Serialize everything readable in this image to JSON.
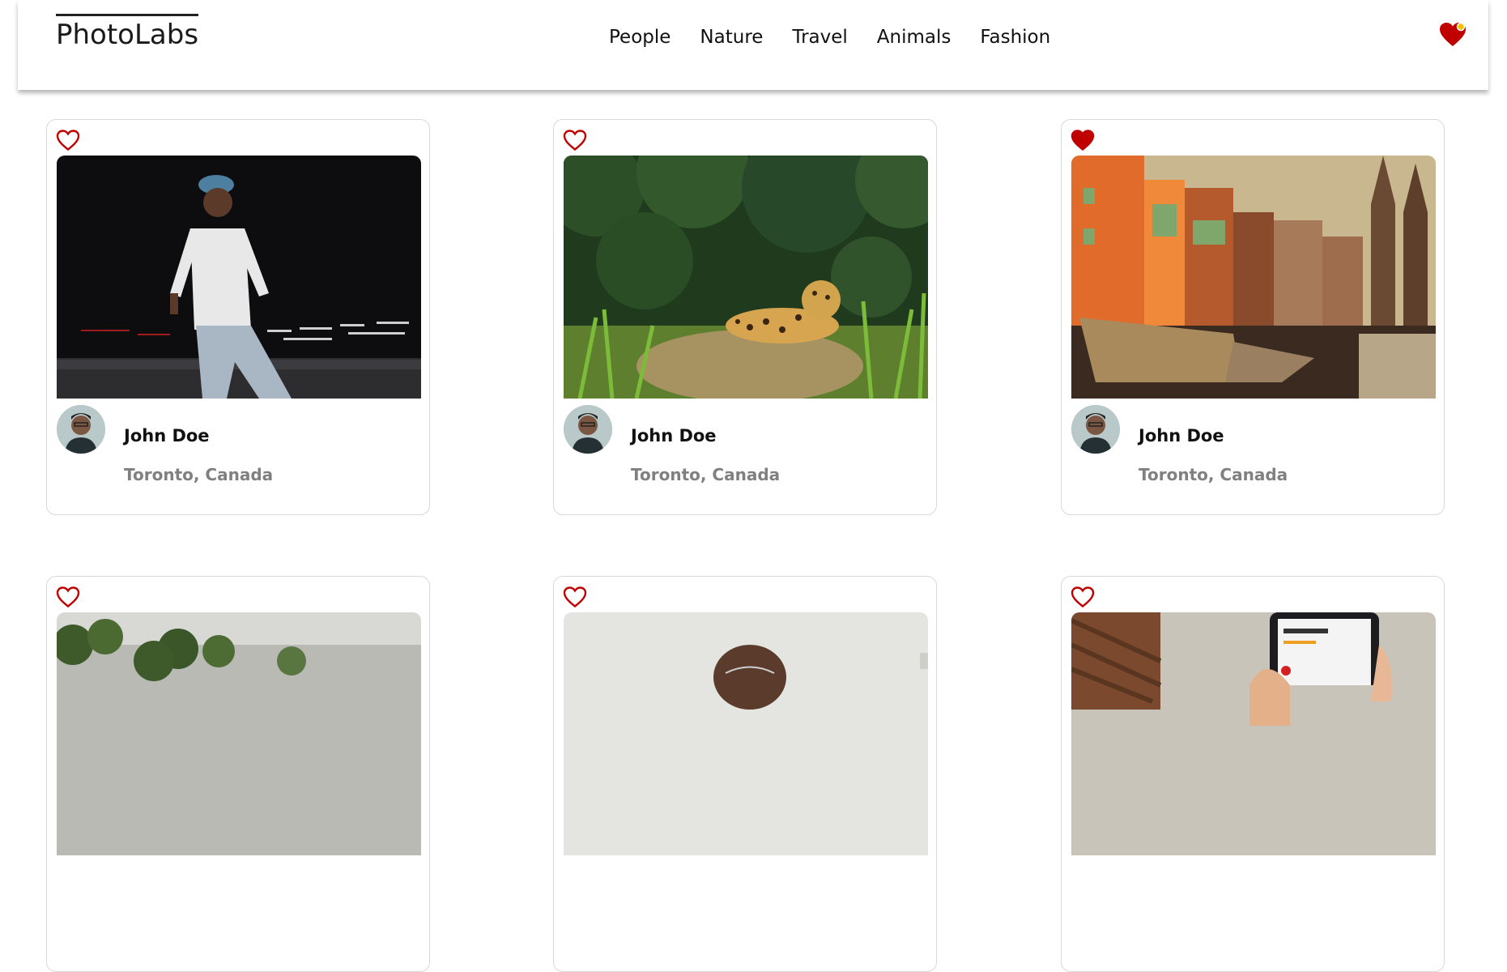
{
  "header": {
    "logo": "PhotoLabs",
    "nav": [
      "People",
      "Nature",
      "Travel",
      "Animals",
      "Fashion"
    ],
    "favorites_icon": "heart-with-notification-dot-icon"
  },
  "colors": {
    "accent": "#c00000",
    "location_text": "#808080",
    "card_border": "#d8d8d8"
  },
  "photos": [
    {
      "scene": "man-walking-at-night",
      "favorited": false,
      "user": {
        "name": "John Doe",
        "location": "Toronto, Canada"
      }
    },
    {
      "scene": "jaguar-in-grass",
      "favorited": false,
      "user": {
        "name": "John Doe",
        "location": "Toronto, Canada"
      }
    },
    {
      "scene": "orange-city-buildings",
      "favorited": true,
      "user": {
        "name": "John Doe",
        "location": "Toronto, Canada"
      }
    },
    {
      "scene": "trees-landscape",
      "favorited": false,
      "user": {
        "name": "",
        "location": ""
      }
    },
    {
      "scene": "man-portrait-light-background",
      "favorited": false,
      "user": {
        "name": "",
        "location": ""
      }
    },
    {
      "scene": "hand-holding-phone",
      "favorited": false,
      "user": {
        "name": "",
        "location": ""
      }
    }
  ]
}
